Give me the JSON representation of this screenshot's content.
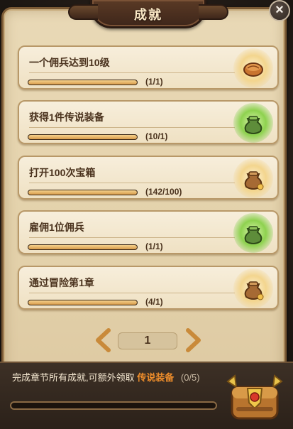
{
  "window": {
    "title": "成就",
    "close_label": "×"
  },
  "achievements": [
    {
      "title": "一个佣兵达到10级",
      "progress_text": "(1/1)",
      "progress_fraction": 1.0,
      "reward_icon": "bread-icon",
      "glow": "gold"
    },
    {
      "title": "获得1件传说装备",
      "progress_text": "(10/1)",
      "progress_fraction": 1.0,
      "reward_icon": "green-pouch-icon",
      "glow": "green"
    },
    {
      "title": "打开100次宝箱",
      "progress_text": "(142/100)",
      "progress_fraction": 1.0,
      "reward_icon": "coin-pouch-icon",
      "glow": "gold"
    },
    {
      "title": "雇佣1位佣兵",
      "progress_text": "(1/1)",
      "progress_fraction": 1.0,
      "reward_icon": "green-pouch-icon",
      "glow": "green"
    },
    {
      "title": "通过冒险第1章",
      "progress_text": "(4/1)",
      "progress_fraction": 1.0,
      "reward_icon": "coin-pouch-icon",
      "glow": "gold"
    }
  ],
  "pager": {
    "current_page": "1",
    "prev_icon": "arrow-left-icon",
    "next_icon": "arrow-right-icon"
  },
  "footer": {
    "text_prefix": "完成章节所有成就,可额外领取",
    "highlight": "传说装备",
    "count": "(0/5)",
    "progress_fraction": 0.0,
    "reward_icon": "golden-chest-icon"
  },
  "colors": {
    "highlight": "#f08e2b",
    "progress_fill": "#d89b4a",
    "panel": "#e9d9b6"
  }
}
